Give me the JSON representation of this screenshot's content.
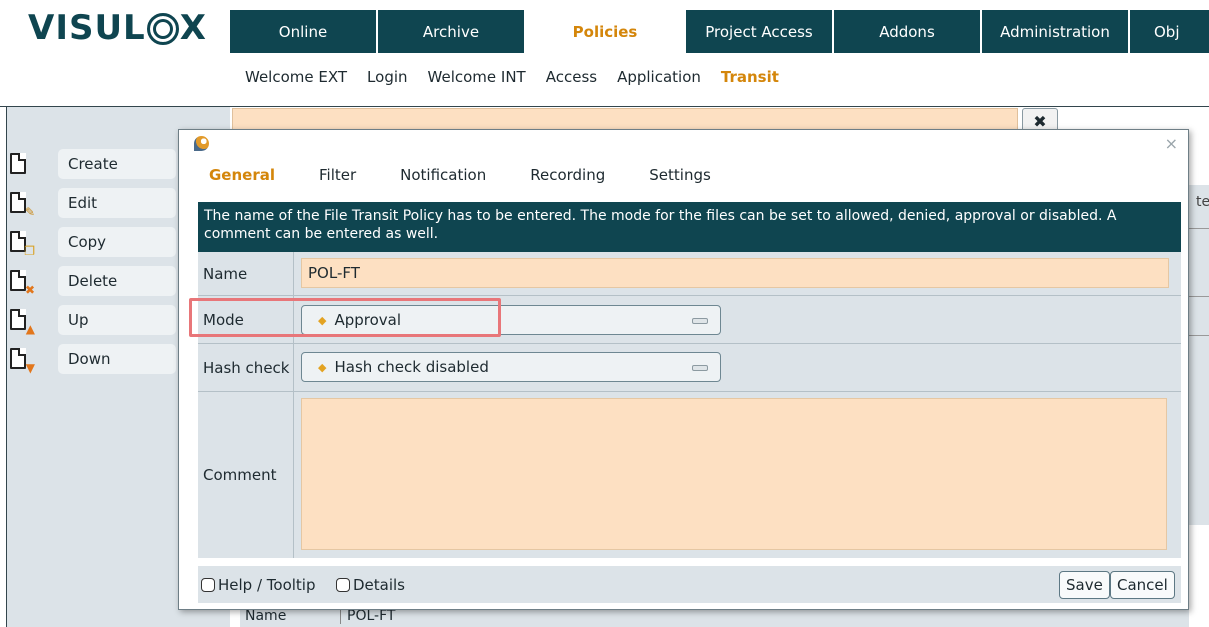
{
  "brand": {
    "logo_left": "VISUL",
    "logo_right": "X"
  },
  "topnav": {
    "tabs": [
      "Online",
      "Archive",
      "Policies",
      "Project Access",
      "Addons",
      "Administration",
      "Obj"
    ],
    "active": "Policies"
  },
  "subnav": {
    "items": [
      "Welcome EXT",
      "Login",
      "Welcome INT",
      "Access",
      "Application",
      "Transit"
    ],
    "active": "Transit"
  },
  "sidebar": {
    "buttons": [
      {
        "label": "Create",
        "icon": "new-document-icon"
      },
      {
        "label": "Edit",
        "icon": "edit-document-icon"
      },
      {
        "label": "Copy",
        "icon": "copy-document-icon"
      },
      {
        "label": "Delete",
        "icon": "delete-document-icon"
      },
      {
        "label": "Up",
        "icon": "move-up-document-icon"
      },
      {
        "label": "Down",
        "icon": "move-down-document-icon"
      }
    ]
  },
  "background": {
    "close_glyph": "✖",
    "right_fragment": "te",
    "bottom_label": "Name",
    "bottom_value": "POL-FT"
  },
  "dialog": {
    "close_glyph": "×",
    "tabs": [
      "General",
      "Filter",
      "Notification",
      "Recording",
      "Settings"
    ],
    "active_tab": "General",
    "info": "The name of the File Transit Policy has to be entered. The mode for the files can be set to allowed, denied, approval or disabled. A comment can be entered as well.",
    "fields": {
      "name_label": "Name",
      "name_value": "POL-FT",
      "mode_label": "Mode",
      "mode_value": "Approval",
      "hash_label": "Hash check",
      "hash_value": "Hash check disabled",
      "comment_label": "Comment",
      "comment_value": ""
    },
    "footer": {
      "help_label": "Help / Tooltip",
      "details_label": "Details",
      "save_label": "Save",
      "cancel_label": "Cancel"
    }
  },
  "colors": {
    "brand_teal": "#0f4550",
    "accent_orange": "#d4860b",
    "field_peach": "#fde0c2",
    "highlight_red": "#e87679"
  }
}
